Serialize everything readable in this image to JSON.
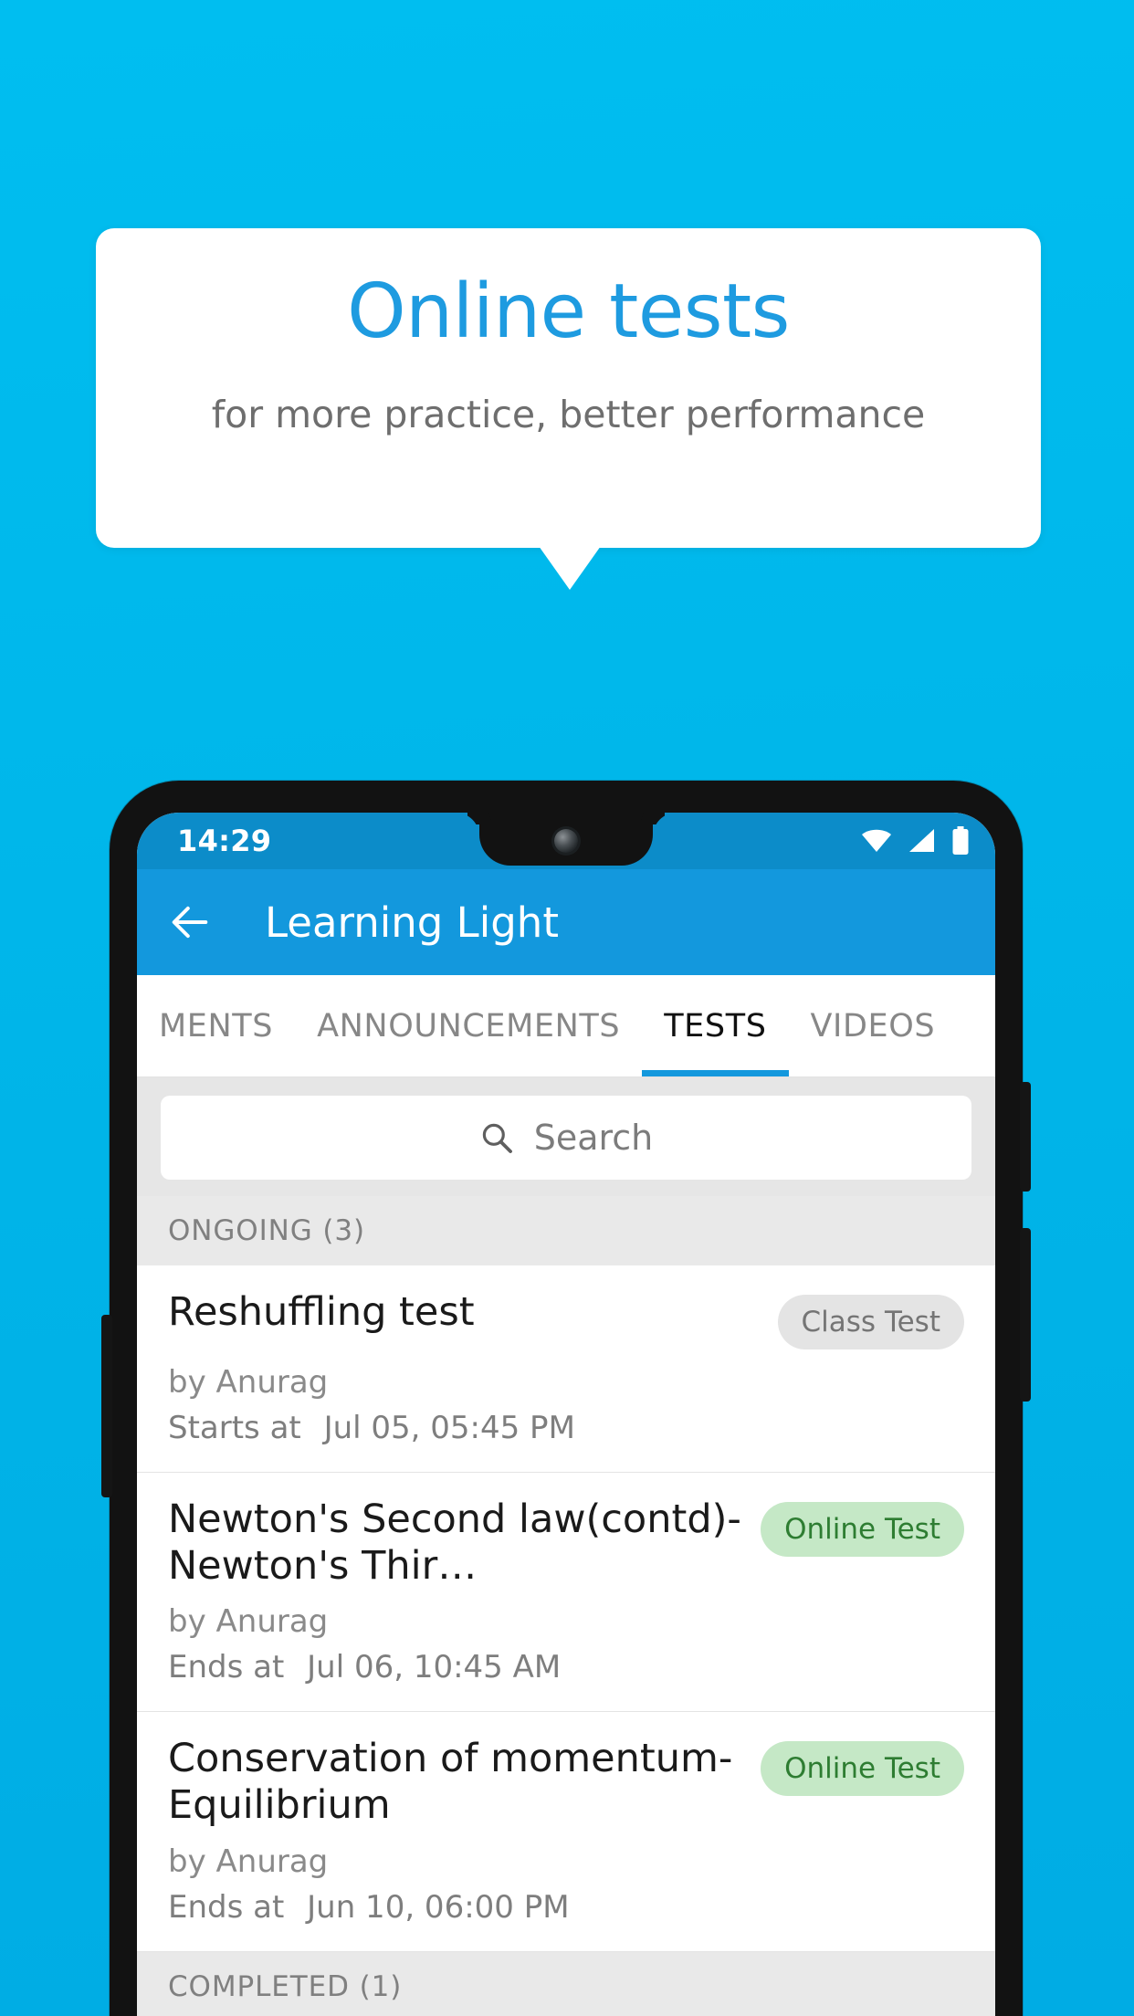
{
  "promo": {
    "title": "Online tests",
    "subtitle": "for more practice, better performance",
    "title_color": "#1E9BE0",
    "background_color": "#00B9EC"
  },
  "phone": {
    "statusbar": {
      "time": "14:29",
      "icons": [
        "wifi-icon",
        "signal-icon",
        "battery-icon"
      ]
    },
    "appbar": {
      "back_icon": "back-arrow-icon",
      "title": "Learning Light",
      "color": "#1398DD"
    },
    "tabs": [
      {
        "label": "MENTS",
        "active": false
      },
      {
        "label": "ANNOUNCEMENTS",
        "active": false
      },
      {
        "label": "TESTS",
        "active": true
      },
      {
        "label": "VIDEOS",
        "active": false
      }
    ],
    "search": {
      "icon": "search-icon",
      "placeholder": "Search",
      "value": ""
    },
    "sections": [
      {
        "header": "ONGOING (3)",
        "items": [
          {
            "title": "Reshuffling test",
            "badge": "Class Test",
            "badge_style": "grey",
            "author": "by Anurag",
            "time_label": "Starts at",
            "time_value": "Jul 05, 05:45 PM"
          },
          {
            "title": "Newton's Second law(contd)-Newton's Thir…",
            "badge": "Online Test",
            "badge_style": "green",
            "author": "by Anurag",
            "time_label": "Ends at",
            "time_value": "Jul 06, 10:45 AM"
          },
          {
            "title": "Conservation of momentum-Equilibrium",
            "badge": "Online Test",
            "badge_style": "green",
            "author": "by Anurag",
            "time_label": "Ends at",
            "time_value": "Jun 10, 06:00 PM"
          }
        ]
      },
      {
        "header": "COMPLETED (1)",
        "items": []
      }
    ]
  }
}
